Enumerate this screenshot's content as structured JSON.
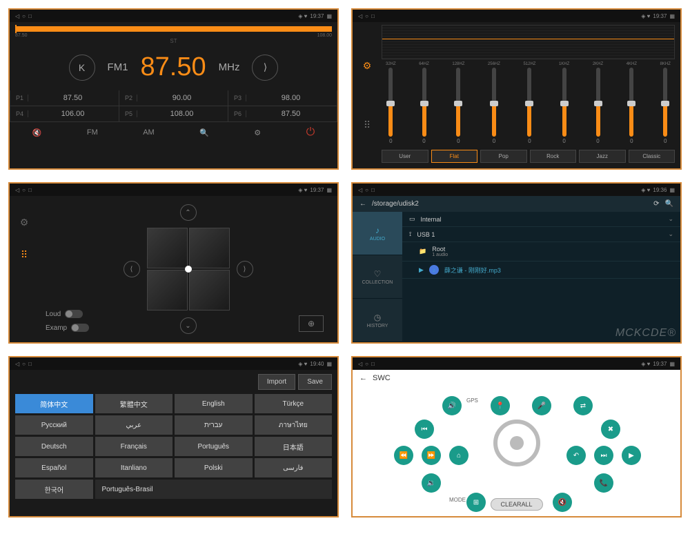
{
  "status": {
    "time1": "19:37",
    "time2": "19:37",
    "time3": "19:37",
    "time4": "19:36",
    "time5": "19:40",
    "time6": "19:37",
    "icons": "◈ ♥"
  },
  "radio": {
    "st": "ST",
    "band": "FM1",
    "freq": "87.50",
    "unit": "MHz",
    "scale_lo": "87.50",
    "scale_hi": "108.00",
    "presets": [
      {
        "n": "P1",
        "f": "87.50"
      },
      {
        "n": "P2",
        "f": "90.00"
      },
      {
        "n": "P3",
        "f": "98.00"
      },
      {
        "n": "P4",
        "f": "106.00"
      },
      {
        "n": "P5",
        "f": "108.00"
      },
      {
        "n": "P6",
        "f": "87.50"
      }
    ],
    "bottom": {
      "fm": "FM",
      "am": "AM"
    }
  },
  "eq": {
    "bands": [
      {
        "hz": "32HZ",
        "v": "0"
      },
      {
        "hz": "64HZ",
        "v": "0"
      },
      {
        "hz": "128HZ",
        "v": "0"
      },
      {
        "hz": "256HZ",
        "v": "0"
      },
      {
        "hz": "512HZ",
        "v": "0"
      },
      {
        "hz": "1KHZ",
        "v": "0"
      },
      {
        "hz": "2KHZ",
        "v": "0"
      },
      {
        "hz": "4KHZ",
        "v": "0"
      },
      {
        "hz": "8KHZ",
        "v": "0"
      }
    ],
    "presets": [
      "User",
      "Flat",
      "Pop",
      "Rock",
      "Jazz",
      "Classic"
    ],
    "active": "Flat"
  },
  "balance": {
    "loud": "Loud",
    "examp": "Examp"
  },
  "files": {
    "path": "/storage/udisk2",
    "tabs": {
      "audio": "AUDIO",
      "collection": "COLLECTION",
      "history": "HISTORY"
    },
    "internal": "Internal",
    "usb": "USB 1",
    "root": "Root",
    "audio_count": "1 audio",
    "playing": "薛之谦 - 刚刚好.mp3"
  },
  "lang": {
    "import": "Import",
    "save": "Save",
    "cells": [
      "简体中文",
      "繁體中文",
      "English",
      "Türkçe",
      "Русский",
      "عربي",
      "עברית",
      "ภาษาไทย",
      "Deutsch",
      "Français",
      "Português",
      "日本語",
      "Español",
      "Itanliano",
      "Polski",
      "فارسی",
      "한국어",
      "Português-Brasil"
    ]
  },
  "swc": {
    "title": "SWC",
    "clear": "CLEARALL",
    "gps": "GPS",
    "mode": "MODE",
    "watermark": "MCKCDE®"
  }
}
